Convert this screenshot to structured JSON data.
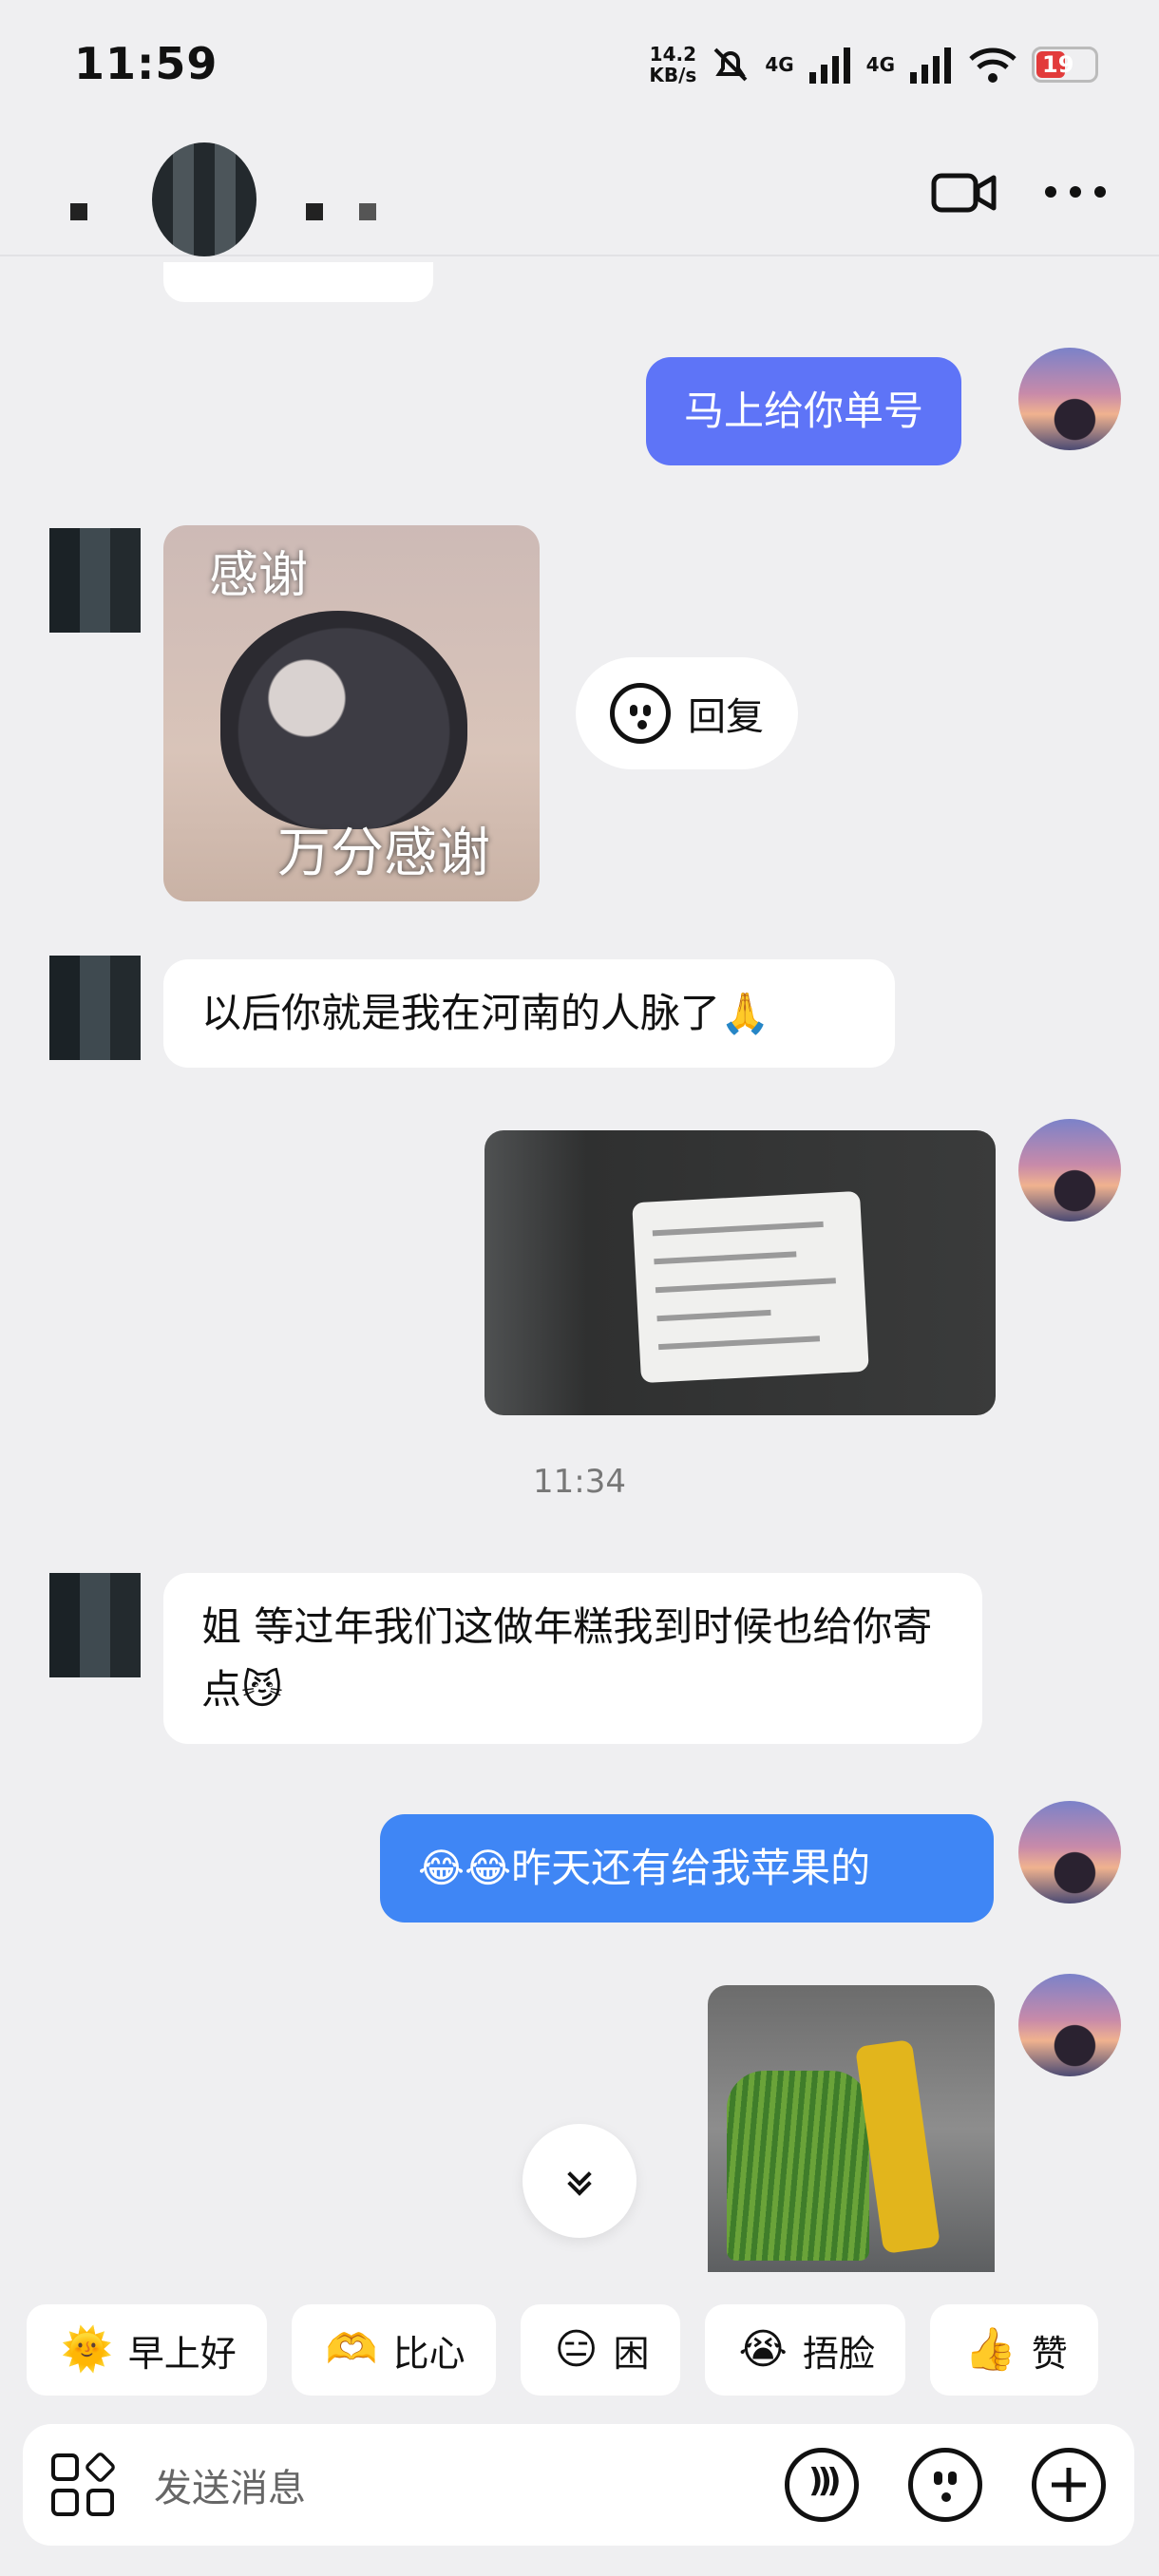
{
  "status_bar": {
    "time": "11:59",
    "net_speed_value": "14.2",
    "net_speed_unit": "KB/s",
    "signal_1": "4G",
    "signal_2": "4G",
    "battery": "19"
  },
  "header": {
    "contact_name_obscured": "",
    "video_icon": "video-camera-icon",
    "more_icon": "more-icon"
  },
  "messages": [
    {
      "side": "right",
      "text": "马上给你单号"
    },
    {
      "side": "left",
      "type": "sticker",
      "caption_top": "感谢",
      "caption_bottom": "万分感谢"
    },
    {
      "side": "left",
      "text": "以后你就是我在河南的人脉了🙏"
    },
    {
      "side": "right",
      "type": "image"
    },
    {
      "side": "left",
      "text": "姐 等过年我们这做年糕我到时候也给你寄点😼"
    },
    {
      "side": "right",
      "text": "😂😂昨天还有给我苹果的"
    },
    {
      "side": "right",
      "type": "image"
    }
  ],
  "reply_pill": {
    "label": "回复"
  },
  "timestamp": "11:34",
  "quick_replies": [
    {
      "emoji": "🌞",
      "label": "早上好"
    },
    {
      "emoji": "🫶",
      "label": "比心"
    },
    {
      "emoji": "😑",
      "label": "困"
    },
    {
      "emoji": "😭",
      "label": "捂脸"
    },
    {
      "emoji": "👍",
      "label": "赞"
    }
  ],
  "input": {
    "placeholder": "发送消息"
  }
}
